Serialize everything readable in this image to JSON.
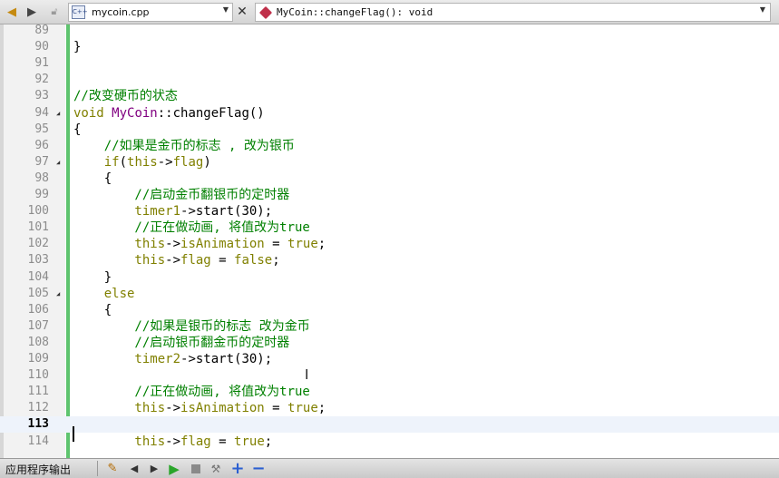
{
  "toolbar": {
    "file_name": "mycoin.cpp",
    "file_icon_text": "C++",
    "function_name": "MyCoin::changeFlag(): void",
    "icons": [
      "back-arrow-icon",
      "forward-arrow-icon",
      "lock-icon",
      "cpp-file-icon",
      "dropdown-arrow-icon",
      "close-icon",
      "function-icon"
    ]
  },
  "editor": {
    "current_line": "113",
    "lines": [
      {
        "n": "89",
        "fold": false,
        "tokens": []
      },
      {
        "n": "90",
        "fold": false,
        "tokens": [
          {
            "t": "}",
            "c": "plain"
          }
        ]
      },
      {
        "n": "91",
        "fold": false,
        "tokens": []
      },
      {
        "n": "92",
        "fold": false,
        "tokens": []
      },
      {
        "n": "93",
        "fold": false,
        "tokens": [
          {
            "t": "//改变硬币的状态",
            "c": "comment"
          }
        ]
      },
      {
        "n": "94",
        "fold": true,
        "tokens": [
          {
            "t": "void ",
            "c": "kw"
          },
          {
            "t": "MyCoin",
            "c": "class"
          },
          {
            "t": "::changeFlag()",
            "c": "plain"
          }
        ]
      },
      {
        "n": "95",
        "fold": false,
        "tokens": [
          {
            "t": "{",
            "c": "plain"
          }
        ]
      },
      {
        "n": "96",
        "fold": false,
        "tokens": [
          {
            "t": "    //如果是金币的标志 , 改为银币",
            "c": "comment"
          }
        ]
      },
      {
        "n": "97",
        "fold": true,
        "tokens": [
          {
            "t": "    if",
            "c": "kw"
          },
          {
            "t": "(",
            "c": "plain"
          },
          {
            "t": "this",
            "c": "kw"
          },
          {
            "t": "->",
            "c": "plain"
          },
          {
            "t": "flag",
            "c": "kw"
          },
          {
            "t": ")",
            "c": "plain"
          }
        ]
      },
      {
        "n": "98",
        "fold": false,
        "tokens": [
          {
            "t": "    {",
            "c": "plain"
          }
        ]
      },
      {
        "n": "99",
        "fold": false,
        "tokens": [
          {
            "t": "        //启动金币翻银币的定时器",
            "c": "comment"
          }
        ]
      },
      {
        "n": "100",
        "fold": false,
        "tokens": [
          {
            "t": "        timer1",
            "c": "kw"
          },
          {
            "t": "->start(30);",
            "c": "plain"
          }
        ]
      },
      {
        "n": "101",
        "fold": false,
        "tokens": [
          {
            "t": "        //正在做动画, 将值改为true",
            "c": "comment"
          }
        ]
      },
      {
        "n": "102",
        "fold": false,
        "tokens": [
          {
            "t": "        this",
            "c": "kw"
          },
          {
            "t": "->",
            "c": "plain"
          },
          {
            "t": "isAnimation",
            "c": "kw"
          },
          {
            "t": " = ",
            "c": "plain"
          },
          {
            "t": "true",
            "c": "kw"
          },
          {
            "t": ";",
            "c": "plain"
          }
        ]
      },
      {
        "n": "103",
        "fold": false,
        "tokens": [
          {
            "t": "        this",
            "c": "kw"
          },
          {
            "t": "->",
            "c": "plain"
          },
          {
            "t": "flag",
            "c": "kw"
          },
          {
            "t": " = ",
            "c": "plain"
          },
          {
            "t": "false",
            "c": "kw"
          },
          {
            "t": ";",
            "c": "plain"
          }
        ]
      },
      {
        "n": "104",
        "fold": false,
        "tokens": [
          {
            "t": "    }",
            "c": "plain"
          }
        ]
      },
      {
        "n": "105",
        "fold": true,
        "tokens": [
          {
            "t": "    else",
            "c": "kw"
          }
        ]
      },
      {
        "n": "106",
        "fold": false,
        "tokens": [
          {
            "t": "    {",
            "c": "plain"
          }
        ]
      },
      {
        "n": "107",
        "fold": false,
        "tokens": [
          {
            "t": "        //如果是银币的标志 改为金币",
            "c": "comment"
          }
        ]
      },
      {
        "n": "108",
        "fold": false,
        "tokens": [
          {
            "t": "        //启动银币翻金币的定时器",
            "c": "comment"
          }
        ]
      },
      {
        "n": "109",
        "fold": false,
        "tokens": [
          {
            "t": "        timer2",
            "c": "kw"
          },
          {
            "t": "->start(30);",
            "c": "plain"
          }
        ]
      },
      {
        "n": "110",
        "fold": false,
        "tokens": []
      },
      {
        "n": "111",
        "fold": false,
        "tokens": [
          {
            "t": "        //正在做动画, 将值改为true",
            "c": "comment"
          }
        ]
      },
      {
        "n": "112",
        "fold": false,
        "tokens": [
          {
            "t": "        this",
            "c": "kw"
          },
          {
            "t": "->",
            "c": "plain"
          },
          {
            "t": "isAnimation",
            "c": "kw"
          },
          {
            "t": " = ",
            "c": "plain"
          },
          {
            "t": "true",
            "c": "kw"
          },
          {
            "t": ";",
            "c": "plain"
          }
        ]
      },
      {
        "n": "113",
        "fold": false,
        "tokens": []
      },
      {
        "n": "114",
        "fold": false,
        "tokens": [
          {
            "t": "        this",
            "c": "kw"
          },
          {
            "t": "->",
            "c": "plain"
          },
          {
            "t": "flag",
            "c": "kw"
          },
          {
            "t": " = ",
            "c": "plain"
          },
          {
            "t": "true",
            "c": "kw"
          },
          {
            "t": ";",
            "c": "plain"
          }
        ]
      }
    ]
  },
  "bottombar": {
    "panel_title": "应用程序输出",
    "icons": [
      "clear-output-icon",
      "previous-icon",
      "next-icon",
      "run-icon",
      "stop-icon",
      "debug-icon",
      "zoom-in-icon",
      "zoom-out-icon"
    ]
  }
}
